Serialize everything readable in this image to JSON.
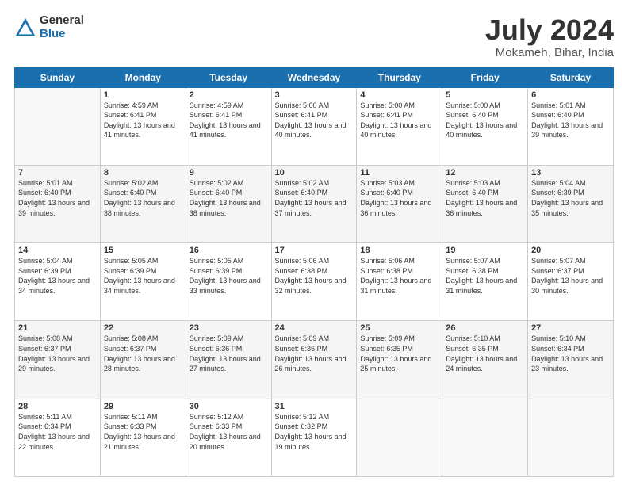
{
  "logo": {
    "general": "General",
    "blue": "Blue"
  },
  "title": {
    "month_year": "July 2024",
    "location": "Mokameh, Bihar, India"
  },
  "days_of_week": [
    "Sunday",
    "Monday",
    "Tuesday",
    "Wednesday",
    "Thursday",
    "Friday",
    "Saturday"
  ],
  "weeks": [
    [
      {
        "num": "",
        "sunrise": "",
        "sunset": "",
        "daylight": "",
        "empty": true
      },
      {
        "num": "1",
        "sunrise": "Sunrise: 4:59 AM",
        "sunset": "Sunset: 6:41 PM",
        "daylight": "Daylight: 13 hours and 41 minutes."
      },
      {
        "num": "2",
        "sunrise": "Sunrise: 4:59 AM",
        "sunset": "Sunset: 6:41 PM",
        "daylight": "Daylight: 13 hours and 41 minutes."
      },
      {
        "num": "3",
        "sunrise": "Sunrise: 5:00 AM",
        "sunset": "Sunset: 6:41 PM",
        "daylight": "Daylight: 13 hours and 40 minutes."
      },
      {
        "num": "4",
        "sunrise": "Sunrise: 5:00 AM",
        "sunset": "Sunset: 6:41 PM",
        "daylight": "Daylight: 13 hours and 40 minutes."
      },
      {
        "num": "5",
        "sunrise": "Sunrise: 5:00 AM",
        "sunset": "Sunset: 6:40 PM",
        "daylight": "Daylight: 13 hours and 40 minutes."
      },
      {
        "num": "6",
        "sunrise": "Sunrise: 5:01 AM",
        "sunset": "Sunset: 6:40 PM",
        "daylight": "Daylight: 13 hours and 39 minutes."
      }
    ],
    [
      {
        "num": "7",
        "sunrise": "Sunrise: 5:01 AM",
        "sunset": "Sunset: 6:40 PM",
        "daylight": "Daylight: 13 hours and 39 minutes."
      },
      {
        "num": "8",
        "sunrise": "Sunrise: 5:02 AM",
        "sunset": "Sunset: 6:40 PM",
        "daylight": "Daylight: 13 hours and 38 minutes."
      },
      {
        "num": "9",
        "sunrise": "Sunrise: 5:02 AM",
        "sunset": "Sunset: 6:40 PM",
        "daylight": "Daylight: 13 hours and 38 minutes."
      },
      {
        "num": "10",
        "sunrise": "Sunrise: 5:02 AM",
        "sunset": "Sunset: 6:40 PM",
        "daylight": "Daylight: 13 hours and 37 minutes."
      },
      {
        "num": "11",
        "sunrise": "Sunrise: 5:03 AM",
        "sunset": "Sunset: 6:40 PM",
        "daylight": "Daylight: 13 hours and 36 minutes."
      },
      {
        "num": "12",
        "sunrise": "Sunrise: 5:03 AM",
        "sunset": "Sunset: 6:40 PM",
        "daylight": "Daylight: 13 hours and 36 minutes."
      },
      {
        "num": "13",
        "sunrise": "Sunrise: 5:04 AM",
        "sunset": "Sunset: 6:39 PM",
        "daylight": "Daylight: 13 hours and 35 minutes."
      }
    ],
    [
      {
        "num": "14",
        "sunrise": "Sunrise: 5:04 AM",
        "sunset": "Sunset: 6:39 PM",
        "daylight": "Daylight: 13 hours and 34 minutes."
      },
      {
        "num": "15",
        "sunrise": "Sunrise: 5:05 AM",
        "sunset": "Sunset: 6:39 PM",
        "daylight": "Daylight: 13 hours and 34 minutes."
      },
      {
        "num": "16",
        "sunrise": "Sunrise: 5:05 AM",
        "sunset": "Sunset: 6:39 PM",
        "daylight": "Daylight: 13 hours and 33 minutes."
      },
      {
        "num": "17",
        "sunrise": "Sunrise: 5:06 AM",
        "sunset": "Sunset: 6:38 PM",
        "daylight": "Daylight: 13 hours and 32 minutes."
      },
      {
        "num": "18",
        "sunrise": "Sunrise: 5:06 AM",
        "sunset": "Sunset: 6:38 PM",
        "daylight": "Daylight: 13 hours and 31 minutes."
      },
      {
        "num": "19",
        "sunrise": "Sunrise: 5:07 AM",
        "sunset": "Sunset: 6:38 PM",
        "daylight": "Daylight: 13 hours and 31 minutes."
      },
      {
        "num": "20",
        "sunrise": "Sunrise: 5:07 AM",
        "sunset": "Sunset: 6:37 PM",
        "daylight": "Daylight: 13 hours and 30 minutes."
      }
    ],
    [
      {
        "num": "21",
        "sunrise": "Sunrise: 5:08 AM",
        "sunset": "Sunset: 6:37 PM",
        "daylight": "Daylight: 13 hours and 29 minutes."
      },
      {
        "num": "22",
        "sunrise": "Sunrise: 5:08 AM",
        "sunset": "Sunset: 6:37 PM",
        "daylight": "Daylight: 13 hours and 28 minutes."
      },
      {
        "num": "23",
        "sunrise": "Sunrise: 5:09 AM",
        "sunset": "Sunset: 6:36 PM",
        "daylight": "Daylight: 13 hours and 27 minutes."
      },
      {
        "num": "24",
        "sunrise": "Sunrise: 5:09 AM",
        "sunset": "Sunset: 6:36 PM",
        "daylight": "Daylight: 13 hours and 26 minutes."
      },
      {
        "num": "25",
        "sunrise": "Sunrise: 5:09 AM",
        "sunset": "Sunset: 6:35 PM",
        "daylight": "Daylight: 13 hours and 25 minutes."
      },
      {
        "num": "26",
        "sunrise": "Sunrise: 5:10 AM",
        "sunset": "Sunset: 6:35 PM",
        "daylight": "Daylight: 13 hours and 24 minutes."
      },
      {
        "num": "27",
        "sunrise": "Sunrise: 5:10 AM",
        "sunset": "Sunset: 6:34 PM",
        "daylight": "Daylight: 13 hours and 23 minutes."
      }
    ],
    [
      {
        "num": "28",
        "sunrise": "Sunrise: 5:11 AM",
        "sunset": "Sunset: 6:34 PM",
        "daylight": "Daylight: 13 hours and 22 minutes."
      },
      {
        "num": "29",
        "sunrise": "Sunrise: 5:11 AM",
        "sunset": "Sunset: 6:33 PM",
        "daylight": "Daylight: 13 hours and 21 minutes."
      },
      {
        "num": "30",
        "sunrise": "Sunrise: 5:12 AM",
        "sunset": "Sunset: 6:33 PM",
        "daylight": "Daylight: 13 hours and 20 minutes."
      },
      {
        "num": "31",
        "sunrise": "Sunrise: 5:12 AM",
        "sunset": "Sunset: 6:32 PM",
        "daylight": "Daylight: 13 hours and 19 minutes."
      },
      {
        "num": "",
        "sunrise": "",
        "sunset": "",
        "daylight": "",
        "empty": true
      },
      {
        "num": "",
        "sunrise": "",
        "sunset": "",
        "daylight": "",
        "empty": true
      },
      {
        "num": "",
        "sunrise": "",
        "sunset": "",
        "daylight": "",
        "empty": true
      }
    ]
  ]
}
